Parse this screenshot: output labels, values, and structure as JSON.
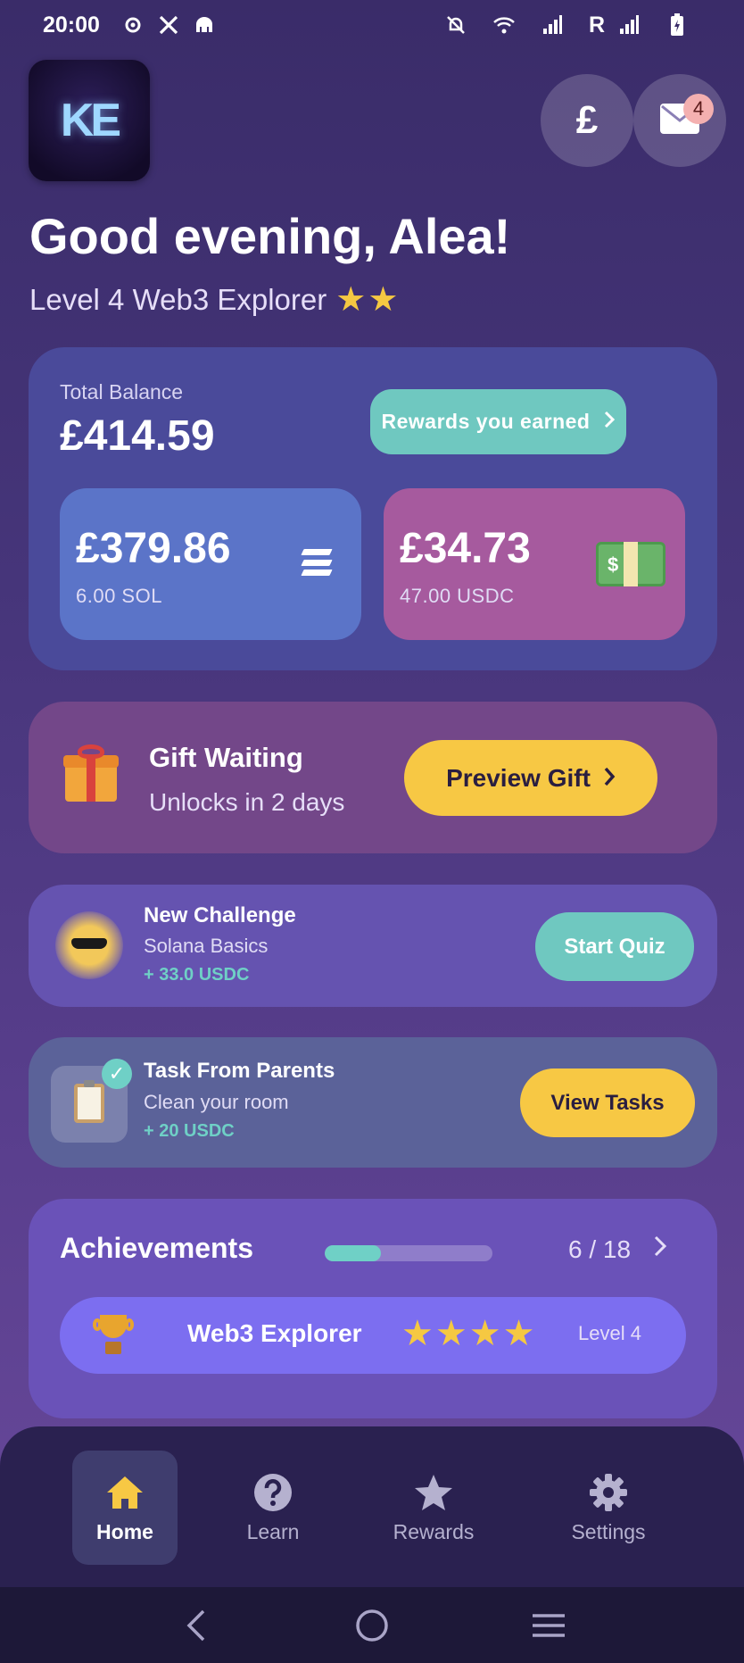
{
  "status_bar": {
    "time": "20:00",
    "carrier_letter": "R"
  },
  "header": {
    "logo_text": "KE",
    "currency_symbol": "£",
    "mail_badge": "4",
    "greeting": "Good evening, Alea!",
    "level_text": "Level 4 Web3 Explorer",
    "level_stars": "★★"
  },
  "balance": {
    "label": "Total Balance",
    "value": "£414.59",
    "rewards_button": "Rewards you earned",
    "sol": {
      "value": "£379.86",
      "amount": "6.00 SOL"
    },
    "usdc": {
      "value": "£34.73",
      "amount": "47.00 USDC",
      "icon": "cash-icon"
    }
  },
  "gift": {
    "title": "Gift Waiting",
    "subtitle": "Unlocks in 2 days",
    "button": "Preview Gift"
  },
  "challenge": {
    "title": "New Challenge",
    "subtitle": "Solana Basics",
    "reward": "+ 33.0 USDC",
    "button": "Start Quiz"
  },
  "task": {
    "title": "Task From Parents",
    "subtitle": "Clean your room",
    "reward": "+ 20 USDC",
    "button": "View Tasks"
  },
  "achievements": {
    "title": "Achievements",
    "progress_fraction": 0.3333,
    "progress_text": "6 / 18",
    "badge_name": "Web3 Explorer",
    "badge_stars": "★★★★",
    "badge_level": "Level 4"
  },
  "nav": {
    "items": [
      {
        "label": "Home",
        "icon": "home-icon",
        "active": true
      },
      {
        "label": "Learn",
        "icon": "help-circle-icon",
        "active": false
      },
      {
        "label": "Rewards",
        "icon": "star-icon",
        "active": false
      },
      {
        "label": "Settings",
        "icon": "gear-icon",
        "active": false
      }
    ]
  },
  "colors": {
    "accent_teal": "#6fc8c0",
    "accent_yellow": "#f7c844",
    "star_gold": "#f5c842"
  }
}
